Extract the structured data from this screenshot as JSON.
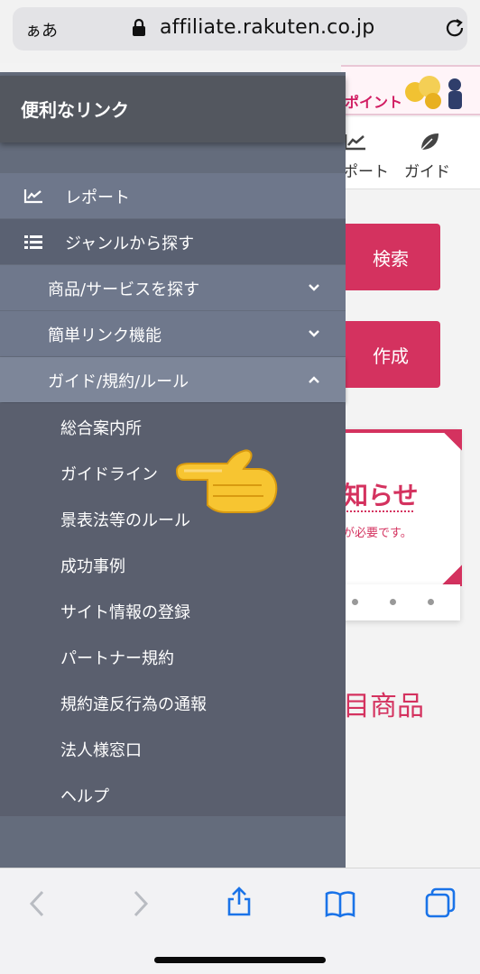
{
  "browser": {
    "text_size_label": "ぁあ",
    "domain": "affiliate.rakuten.co.jp",
    "icons": [
      "lock-icon",
      "reload-icon"
    ]
  },
  "background_page": {
    "banner_text": "ポイント",
    "nav_items": [
      {
        "label": "ポート",
        "icon": "chart-icon"
      },
      {
        "label": "ガイド",
        "icon": "leaf-icon"
      }
    ],
    "search_button": "検索",
    "create_button": "作成",
    "notice_title": "知らせ",
    "notice_subtitle": "が必要です。",
    "section_heading": "目商品",
    "accent_color": "#d4325f"
  },
  "drawer": {
    "title": "便利なリンク",
    "items": [
      {
        "label": "レポート",
        "icon": "chart-icon"
      },
      {
        "label": "ジャンルから探す",
        "icon": "list-icon"
      }
    ],
    "accordion": [
      {
        "label": "商品/サービスを探す",
        "state": "collapsed"
      },
      {
        "label": "簡単リンク機能",
        "state": "collapsed"
      },
      {
        "label": "ガイド/規約/ルール",
        "state": "expanded"
      }
    ],
    "sub_items": [
      "総合案内所",
      "ガイドライン",
      "景表法等のルール",
      "成功事例",
      "サイト情報の登録",
      "パートナー規約",
      "規約違反行為の通報",
      "法人様窓口",
      "ヘルプ"
    ],
    "colors": {
      "header": "#53575f",
      "panel": "#646c7c",
      "submenu": "#5a5f6e"
    }
  },
  "overlay": {
    "pointer": "pointing-hand-icon"
  },
  "toolbar": {
    "icons": [
      "back-icon",
      "forward-icon",
      "share-icon",
      "bookmarks-icon",
      "tabs-icon"
    ],
    "tint": "#1a73e8"
  }
}
